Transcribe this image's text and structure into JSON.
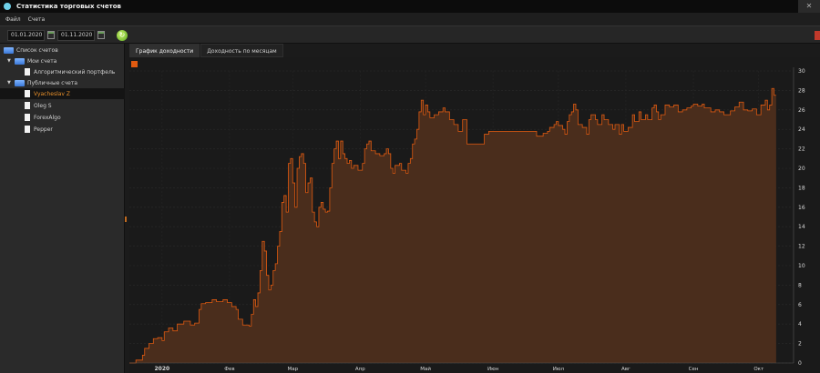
{
  "window": {
    "title": "Статистика торговых счетов"
  },
  "menu": {
    "file": "Файл",
    "accounts": "Счета"
  },
  "toolbar": {
    "date_from": "01.01.2020",
    "date_to": "01.11.2020"
  },
  "tree": {
    "root": "Список счетов",
    "my_accounts": "Мои счета",
    "my_items": [
      "Алгоритмический портфель"
    ],
    "public_accounts": "Публичные счета",
    "public_items": [
      "Vyacheslav Z",
      "Oleg S",
      "ForexAlgo",
      "Pepper"
    ],
    "selected": "Vyacheslav Z"
  },
  "tabs": [
    "График доходности",
    "Доходность по месяцам"
  ],
  "colors": {
    "series": "#e05a10",
    "fill": "#4a2d1c",
    "selected_text": "#e8902a"
  },
  "chart_data": {
    "type": "area",
    "title": "",
    "xlabel": "",
    "ylabel": "",
    "ylim": [
      0,
      30
    ],
    "y_ticks": [
      0,
      2,
      4,
      6,
      8,
      10,
      12,
      14,
      16,
      18,
      20,
      22,
      24,
      26,
      28,
      30
    ],
    "x_ticks": [
      {
        "label": "2020",
        "day": 0
      },
      {
        "label": "Фев",
        "day": 31
      },
      {
        "label": "Мар",
        "day": 60
      },
      {
        "label": "Апр",
        "day": 91
      },
      {
        "label": "Май",
        "day": 121
      },
      {
        "label": "Июн",
        "day": 152
      },
      {
        "label": "Июл",
        "day": 182
      },
      {
        "label": "Авг",
        "day": 213
      },
      {
        "label": "Сен",
        "day": 244
      },
      {
        "label": "Окт",
        "day": 274
      }
    ],
    "x_range_days": [
      -15,
      290
    ],
    "series": [
      {
        "values": [
          [
            -15,
            0
          ],
          [
            -13,
            0
          ],
          [
            -12,
            0.3
          ],
          [
            -9,
            0.8
          ],
          [
            -8,
            1.5
          ],
          [
            -6,
            2.0
          ],
          [
            -4,
            2.5
          ],
          [
            -2,
            2.6
          ],
          [
            0,
            2.3
          ],
          [
            1,
            3.2
          ],
          [
            3,
            3.6
          ],
          [
            5,
            3.3
          ],
          [
            7,
            4.0
          ],
          [
            10,
            4.3
          ],
          [
            13,
            3.9
          ],
          [
            15,
            4.1
          ],
          [
            17,
            5.5
          ],
          [
            18,
            6.1
          ],
          [
            20,
            6.2
          ],
          [
            23,
            6.5
          ],
          [
            25,
            6.3
          ],
          [
            28,
            6.5
          ],
          [
            30,
            6.2
          ],
          [
            32,
            5.8
          ],
          [
            34,
            5.5
          ],
          [
            35,
            4.5
          ],
          [
            37,
            3.9
          ],
          [
            40,
            3.8
          ],
          [
            41,
            5.0
          ],
          [
            42,
            6.5
          ],
          [
            43,
            5.8
          ],
          [
            44,
            7.2
          ],
          [
            45,
            9.5
          ],
          [
            46,
            12.5
          ],
          [
            47,
            11.5
          ],
          [
            48,
            9.0
          ],
          [
            49,
            7.5
          ],
          [
            50,
            8.0
          ],
          [
            51,
            9.5
          ],
          [
            52,
            10.2
          ],
          [
            53,
            12.0
          ],
          [
            54,
            13.5
          ],
          [
            55,
            16.5
          ],
          [
            56,
            17.2
          ],
          [
            57,
            15.5
          ],
          [
            58,
            20.5
          ],
          [
            59,
            21.0
          ],
          [
            60,
            18.5
          ],
          [
            61,
            16.0
          ],
          [
            62,
            20.0
          ],
          [
            63,
            21.2
          ],
          [
            64,
            21.5
          ],
          [
            65,
            20.5
          ],
          [
            66,
            17.5
          ],
          [
            67,
            18.5
          ],
          [
            68,
            19.0
          ],
          [
            69,
            15.5
          ],
          [
            70,
            14.5
          ],
          [
            71,
            14.0
          ],
          [
            72,
            16.0
          ],
          [
            73,
            16.5
          ],
          [
            74,
            15.8
          ],
          [
            75,
            15.5
          ],
          [
            76,
            15.6
          ],
          [
            77,
            18.0
          ],
          [
            78,
            20.5
          ],
          [
            79,
            22.0
          ],
          [
            80,
            22.8
          ],
          [
            81,
            21.0
          ],
          [
            82,
            22.8
          ],
          [
            83,
            21.5
          ],
          [
            84,
            21.0
          ],
          [
            85,
            20.5
          ],
          [
            86,
            20.8
          ],
          [
            87,
            20.0
          ],
          [
            88,
            20.3
          ],
          [
            90,
            19.8
          ],
          [
            92,
            20.5
          ],
          [
            93,
            22.0
          ],
          [
            94,
            22.5
          ],
          [
            95,
            22.8
          ],
          [
            96,
            21.8
          ],
          [
            98,
            21.5
          ],
          [
            100,
            21.3
          ],
          [
            102,
            21.5
          ],
          [
            103,
            22.0
          ],
          [
            104,
            21.5
          ],
          [
            105,
            20.0
          ],
          [
            106,
            19.5
          ],
          [
            107,
            20.3
          ],
          [
            109,
            20.5
          ],
          [
            110,
            19.8
          ],
          [
            112,
            19.5
          ],
          [
            113,
            20.5
          ],
          [
            114,
            21.0
          ],
          [
            115,
            22.5
          ],
          [
            116,
            23.0
          ],
          [
            117,
            24.0
          ],
          [
            118,
            25.8
          ],
          [
            119,
            27.0
          ],
          [
            120,
            25.5
          ],
          [
            121,
            26.5
          ],
          [
            122,
            25.8
          ],
          [
            123,
            25.2
          ],
          [
            125,
            25.5
          ],
          [
            127,
            25.8
          ],
          [
            129,
            26.2
          ],
          [
            130,
            25.8
          ],
          [
            132,
            25.0
          ],
          [
            134,
            24.5
          ],
          [
            136,
            23.8
          ],
          [
            138,
            25.0
          ],
          [
            140,
            22.5
          ],
          [
            146,
            22.5
          ],
          [
            148,
            23.5
          ],
          [
            150,
            23.8
          ],
          [
            170,
            23.8
          ],
          [
            172,
            23.3
          ],
          [
            175,
            23.6
          ],
          [
            177,
            23.8
          ],
          [
            178,
            24.2
          ],
          [
            180,
            24.5
          ],
          [
            181,
            24.8
          ],
          [
            182,
            24.4
          ],
          [
            184,
            24.0
          ],
          [
            185,
            23.5
          ],
          [
            186,
            24.8
          ],
          [
            187,
            25.5
          ],
          [
            188,
            25.8
          ],
          [
            189,
            26.6
          ],
          [
            190,
            26.0
          ],
          [
            191,
            24.5
          ],
          [
            193,
            24.2
          ],
          [
            195,
            23.5
          ],
          [
            196,
            25.0
          ],
          [
            197,
            25.5
          ],
          [
            199,
            25.0
          ],
          [
            200,
            24.5
          ],
          [
            202,
            25.5
          ],
          [
            203,
            25.0
          ],
          [
            205,
            24.5
          ],
          [
            207,
            24.0
          ],
          [
            208,
            24.5
          ],
          [
            210,
            23.5
          ],
          [
            211,
            24.5
          ],
          [
            212,
            23.8
          ],
          [
            214,
            24.2
          ],
          [
            216,
            25.5
          ],
          [
            217,
            24.8
          ],
          [
            219,
            25.8
          ],
          [
            220,
            25.0
          ],
          [
            222,
            25.5
          ],
          [
            223,
            25.0
          ],
          [
            225,
            26.2
          ],
          [
            226,
            26.5
          ],
          [
            227,
            25.8
          ],
          [
            228,
            25.0
          ],
          [
            229,
            25.5
          ],
          [
            231,
            26.5
          ],
          [
            233,
            26.3
          ],
          [
            235,
            26.5
          ],
          [
            237,
            25.8
          ],
          [
            239,
            26.0
          ],
          [
            241,
            26.2
          ],
          [
            243,
            26.4
          ],
          [
            244,
            26.6
          ],
          [
            246,
            26.4
          ],
          [
            248,
            26.6
          ],
          [
            249,
            26.2
          ],
          [
            252,
            25.8
          ],
          [
            254,
            26.0
          ],
          [
            256,
            25.8
          ],
          [
            258,
            25.5
          ],
          [
            261,
            25.9
          ],
          [
            263,
            26.3
          ],
          [
            265,
            26.8
          ],
          [
            267,
            26.0
          ],
          [
            269,
            25.9
          ],
          [
            271,
            26.1
          ],
          [
            273,
            25.5
          ],
          [
            275,
            26.5
          ],
          [
            277,
            27.0
          ],
          [
            278,
            26.0
          ],
          [
            279,
            26.5
          ],
          [
            280,
            28.2
          ],
          [
            281,
            27.5
          ],
          [
            282,
            27.5
          ]
        ]
      }
    ]
  }
}
